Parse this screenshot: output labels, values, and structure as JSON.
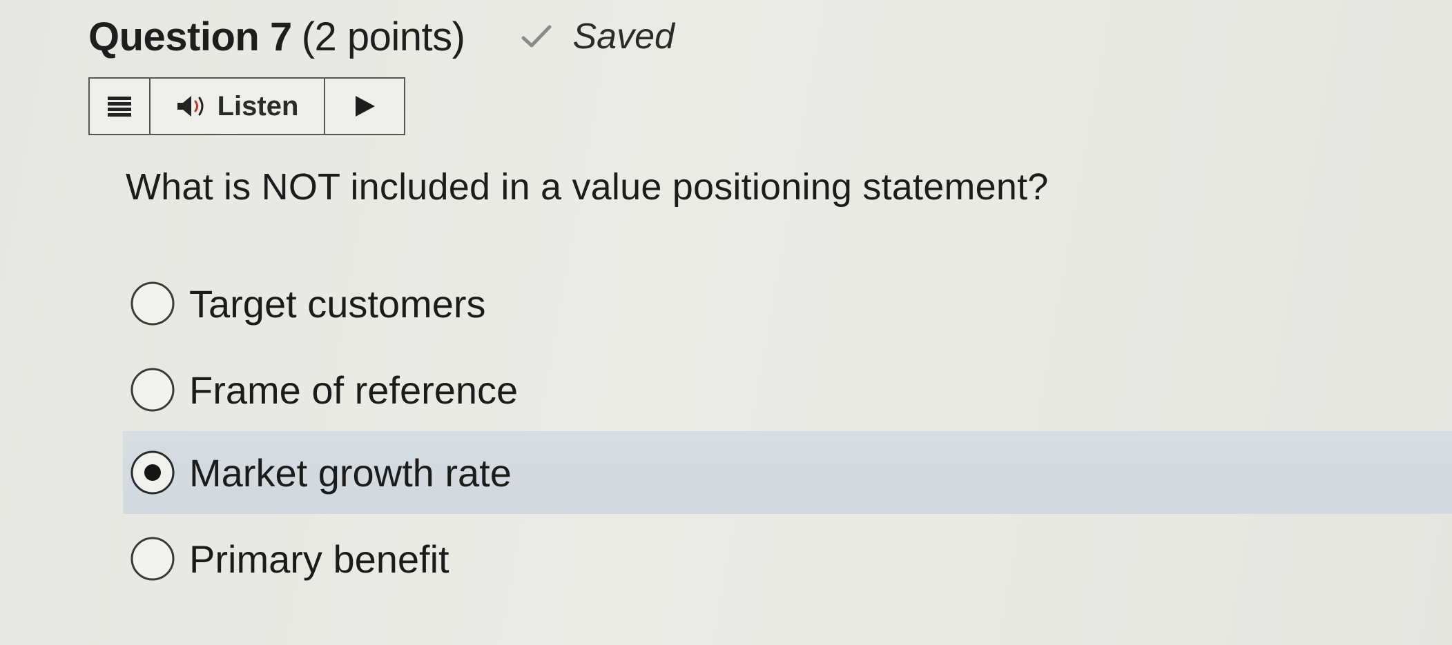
{
  "question": {
    "title": "Question 7",
    "points": "(2 points)",
    "status": "Saved",
    "text": "What is NOT included in a value positioning statement?"
  },
  "toolbar": {
    "menu_icon": "hamburger-icon",
    "speaker_icon": "speaker-icon",
    "listen_label": "Listen",
    "play_icon": "play-icon"
  },
  "options": [
    {
      "label": "Target customers",
      "selected": false
    },
    {
      "label": "Frame of reference",
      "selected": false
    },
    {
      "label": "Market growth rate",
      "selected": true
    },
    {
      "label": "Primary benefit",
      "selected": false
    }
  ],
  "colors": {
    "selected_background": "#d4dadf",
    "check_mark": "#8a8a8a",
    "radio_border": "#3a3a3a"
  }
}
